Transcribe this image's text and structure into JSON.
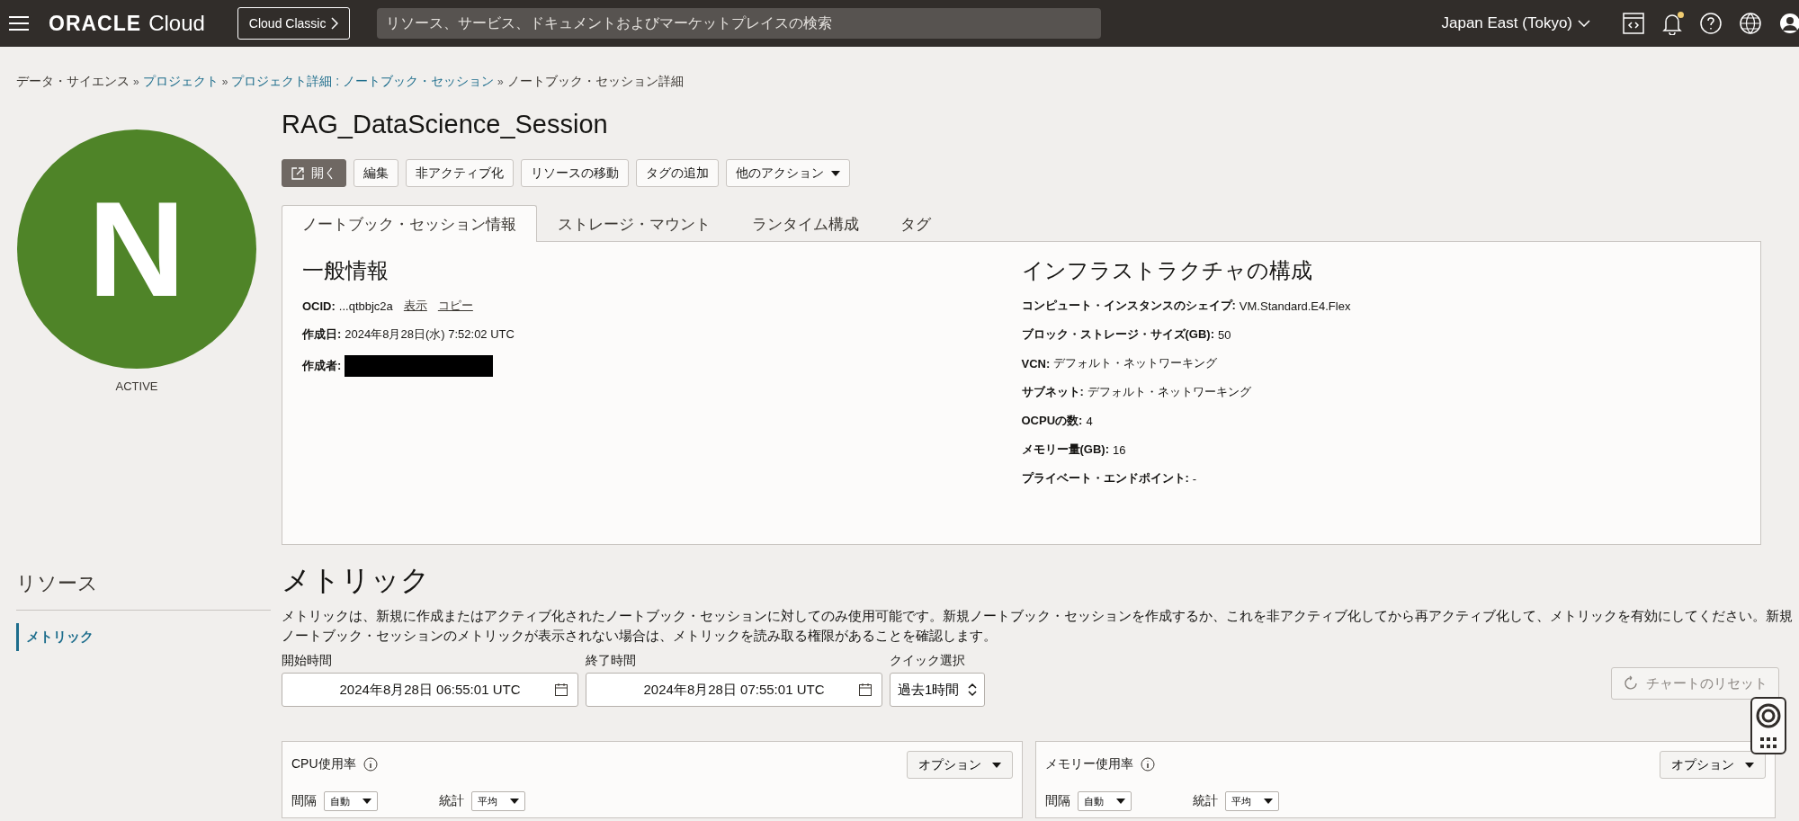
{
  "topbar": {
    "brand_main": "ORACLE",
    "brand_sub": "Cloud",
    "classic_button": "Cloud Classic",
    "search_placeholder": "リソース、サービス、ドキュメントおよびマーケットプレイスの検索",
    "region": "Japan East (Tokyo)",
    "has_notification": true
  },
  "breadcrumb_separator": "»",
  "breadcrumb": [
    {
      "label": "データ・サイエンス",
      "link": false
    },
    {
      "label": "プロジェクト",
      "link": true
    },
    {
      "label": "プロジェクト詳細 : ノートブック・セッション",
      "link": true
    },
    {
      "label": "ノートブック・セッション詳細",
      "link": false
    }
  ],
  "avatar": {
    "letter": "N",
    "status": "ACTIVE",
    "color": "#4f8428"
  },
  "title": "RAG_DataScience_Session",
  "actions": [
    {
      "label": "開く",
      "kind": "primary"
    },
    {
      "label": "編集",
      "kind": "plain"
    },
    {
      "label": "非アクティブ化",
      "kind": "plain"
    },
    {
      "label": "リソースの移動",
      "kind": "plain"
    },
    {
      "label": "タグの追加",
      "kind": "plain"
    },
    {
      "label": "他のアクション",
      "kind": "menu"
    }
  ],
  "tabs": [
    {
      "label": "ノートブック・セッション情報",
      "selected": true
    },
    {
      "label": "ストレージ・マウント",
      "selected": false
    },
    {
      "label": "ランタイム構成",
      "selected": false
    },
    {
      "label": "タグ",
      "selected": false
    }
  ],
  "general": {
    "heading": "一般情報",
    "ocid_label": "OCID:",
    "ocid_value": "...qtbbjc2a",
    "show_link": "表示",
    "copy_link": "コピー",
    "created_label": "作成日:",
    "created_value": "2024年8月28日(水) 7:52:02 UTC",
    "creator_label": "作成者:",
    "creator_redacted": true
  },
  "infrastructure": {
    "heading": "インフラストラクチャの構成",
    "fields": [
      {
        "label": "コンピュート・インスタンスのシェイプ:",
        "value": "VM.Standard.E4.Flex"
      },
      {
        "label": "ブロック・ストレージ・サイズ(GB):",
        "value": "50"
      },
      {
        "label": "VCN:",
        "value": "デフォルト・ネットワーキング"
      },
      {
        "label": "サブネット:",
        "value": "デフォルト・ネットワーキング"
      },
      {
        "label": "OCPUの数:",
        "value": "4"
      },
      {
        "label": "メモリー量(GB):",
        "value": "16"
      },
      {
        "label": "プライベート・エンドポイント:",
        "value": "-"
      }
    ]
  },
  "resources": {
    "heading": "リソース",
    "items": [
      {
        "label": "メトリック",
        "selected": true
      }
    ]
  },
  "metrics": {
    "heading": "メトリック",
    "description": "メトリックは、新規に作成またはアクティブ化されたノートブック・セッションに対してのみ使用可能です。新規ノートブック・セッションを作成するか、これを非アクティブ化してから再アクティブ化して、メトリックを有効にしてください。新規ノートブック・セッションのメトリックが表示されない場合は、メトリックを読み取る権限があることを確認します。",
    "start_label": "開始時間",
    "start_value": "2024年8月28日 06:55:01 UTC",
    "end_label": "終了時間",
    "end_value": "2024年8月28日 07:55:01 UTC",
    "quick_label": "クイック選択",
    "quick_value": "過去1時間",
    "reset_button": {
      "label": "チャートのリセット",
      "disabled": true
    },
    "charts": [
      {
        "title": "CPU使用率",
        "options": "オプション",
        "interval_label": "間隔",
        "interval_value": "自動",
        "stat_label": "統計",
        "stat_value": "平均"
      },
      {
        "title": "メモリー使用率",
        "options": "オプション",
        "interval_label": "間隔",
        "interval_value": "自動",
        "stat_label": "統計",
        "stat_value": "平均"
      }
    ]
  }
}
